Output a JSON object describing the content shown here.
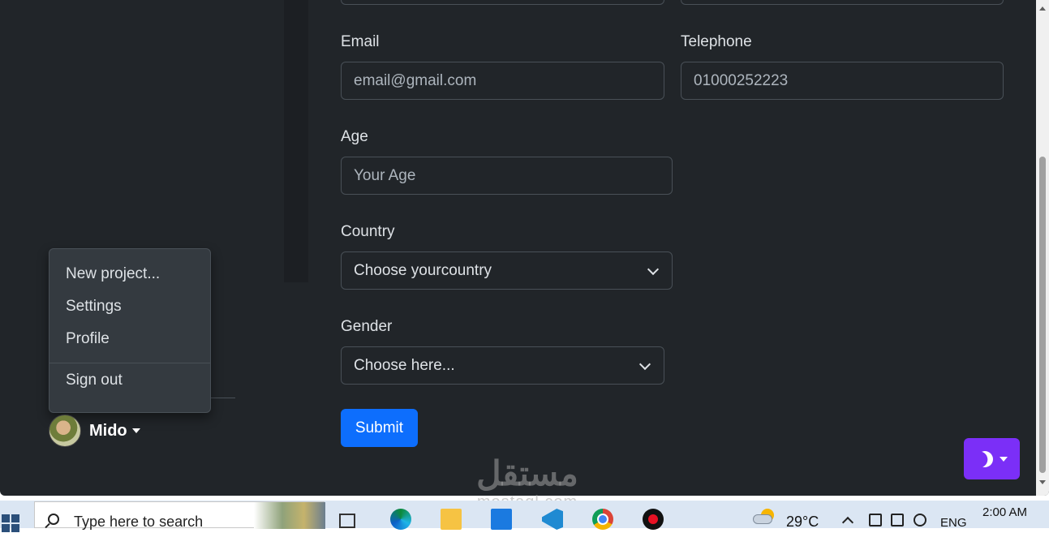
{
  "form": {
    "email": {
      "label": "Email",
      "placeholder": "email@gmail.com"
    },
    "telephone": {
      "label": "Telephone",
      "placeholder": "01000252223"
    },
    "age": {
      "label": "Age",
      "placeholder": "Your Age"
    },
    "country": {
      "label": "Country",
      "selected": "Choose yourcountry"
    },
    "gender": {
      "label": "Gender",
      "selected": "Choose here..."
    },
    "submit_label": "Submit"
  },
  "user_menu": {
    "items": [
      "New project...",
      "Settings",
      "Profile"
    ],
    "sign_out": "Sign out",
    "username": "Mido"
  },
  "theme_toggle": {
    "icon": "moon-stars-icon",
    "color": "#7b2ff7"
  },
  "watermark": {
    "main": "مستقل",
    "sub": "mostaql.com"
  },
  "taskbar": {
    "search_placeholder": "Type here to search",
    "apps": [
      "task-view",
      "edge",
      "file-explorer",
      "mail",
      "vscode",
      "chrome",
      "recorder"
    ],
    "temperature": "29°C",
    "language": "ENG",
    "time": "2:00 AM"
  },
  "colors": {
    "background": "#212529",
    "border": "#495057",
    "primary": "#0d6efd",
    "dropdown_bg": "#343a40"
  }
}
